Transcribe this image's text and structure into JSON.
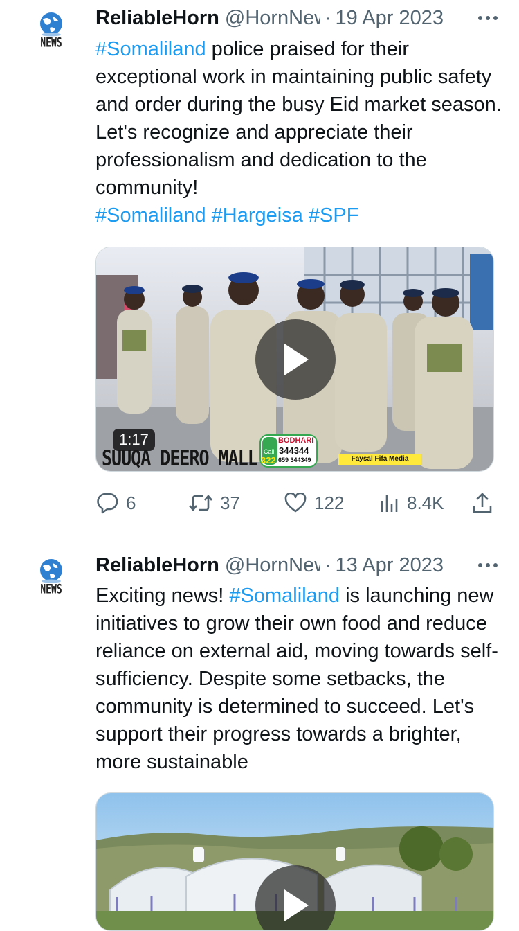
{
  "tweets": [
    {
      "avatar_label": "NEWS",
      "author_name": "ReliableHorn",
      "handle": "@HornNews",
      "separator": "·",
      "date": "19 Apr 2023",
      "text_parts": {
        "tag1": "#Somaliland",
        "body": " police praised for their exceptional work in maintaining public safety and order during the busy Eid market season. Let's recognize and appreciate their professionalism and dedication to the community!",
        "tag2": "#Somaliland",
        "tag3": "#Hargeisa",
        "tag4": "#SPF"
      },
      "media": {
        "duration": "1:17",
        "caption": "SUUQA DEERO MALL",
        "sponsor_name": "BODHARI",
        "sponsor_call": "Call",
        "sponsor_code": "322",
        "sponsor_phone": "344344",
        "sponsor_phone2": "659 344349",
        "credit": "Faysal Fifa Media"
      },
      "stats": {
        "replies": "6",
        "retweets": "37",
        "likes": "122",
        "views": "8.4K"
      }
    },
    {
      "avatar_label": "NEWS",
      "author_name": "ReliableHorn",
      "handle": "@HornNews",
      "separator": "·",
      "date": "13 Apr 2023",
      "text_parts": {
        "lead": "Exciting news! ",
        "tag1": "#Somaliland",
        "body": " is launching new initiatives to grow their own food and reduce reliance on external aid, moving towards self-sufficiency. Despite some setbacks, the community is determined to succeed. Let's support their progress towards a brighter, more sustainable"
      }
    }
  ],
  "icons": [
    "globe-news-logo-icon",
    "more-icon",
    "play-icon",
    "reply-icon",
    "retweet-icon",
    "like-icon",
    "views-icon",
    "share-icon"
  ],
  "colors": {
    "link": "#1d9bf0",
    "secondary_text": "#536471",
    "primary_text": "#0f1419"
  }
}
